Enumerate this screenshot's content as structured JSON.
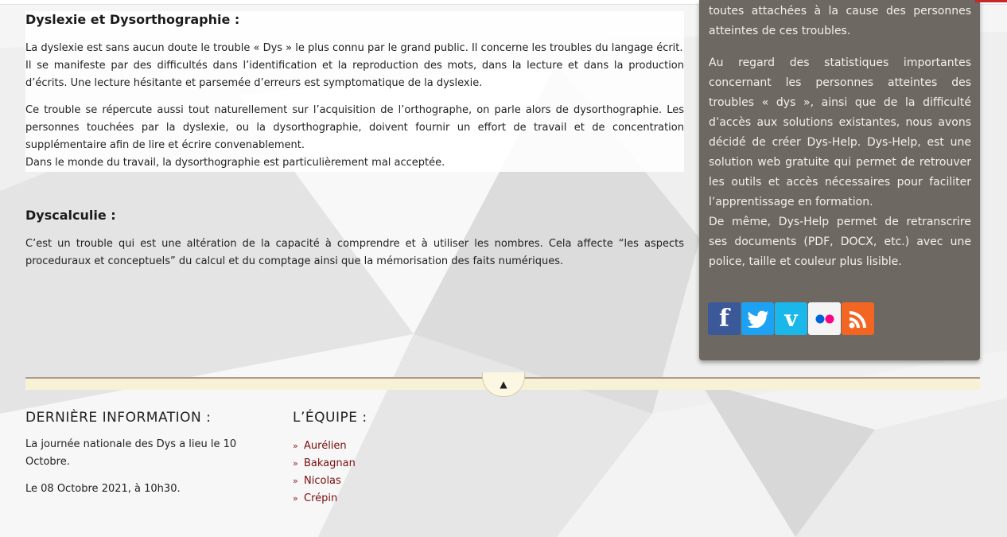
{
  "main": {
    "dyslexie": {
      "title": "Dyslexie et Dysorthographie :",
      "p1_line1": "La dyslexie est sans aucun doute le trouble « Dys » le plus connu par le grand public. Il concerne les troubles du langage écrit.",
      "p1_line2": "Il se manifeste par des difficultés dans l’identification et la reproduction des mots, dans la lecture et dans la production d’écrits. Une lecture hésitante et parsemée d’erreurs est symptomatique de la dyslexie.",
      "p2_line1": "Ce trouble se répercute aussi tout naturellement sur l’acquisition de l’orthographe, on parle alors de dysorthographie. Les personnes touchées par la dyslexie, ou la dysorthographie, doivent fournir un effort de travail et de concentration supplémentaire afin de lire et écrire convenablement.",
      "p2_line2": "Dans le monde du travail, la dysorthographie est particulièrement mal acceptée."
    },
    "dyscalculie": {
      "title": "Dyscalculie :",
      "p1": "C’est un trouble qui est une altération de la capacité à comprendre et à utiliser les nombres. Cela affecte “les aspects proceduraux et conceptuels” du calcul et du comptage ainsi que la mémorisation des faits numériques."
    }
  },
  "sidebar": {
    "p1": "toutes attachées à la cause des personnes atteintes de ces troubles.",
    "p2": "Au regard des statistiques importantes concernant les personnes atteintes des troubles « dys », ainsi que de la difficulté d’accès aux solutions existantes, nous avons décidé de créer Dys-Help. Dys-Help, est une solution web gratuite qui permet de retrouver les outils et accès nécessaires pour faciliter l’apprentissage en formation.",
    "p3": "De même, Dys-Help permet de retranscrire ses documents (PDF, DOCX, etc.) avec une police, taille et couleur plus lisible.",
    "social": [
      {
        "icon": "facebook-icon",
        "glyph": "f",
        "color": "#3b5998"
      },
      {
        "icon": "twitter-icon",
        "glyph": "🐦",
        "color": "#1da1f2"
      },
      {
        "icon": "vimeo-icon",
        "glyph": "v",
        "color": "#1ab7ea"
      },
      {
        "icon": "flickr-icon",
        "glyph": "●●",
        "color": "#f4f4f4"
      },
      {
        "icon": "rss-icon",
        "glyph": ")",
        "color": "#f26522"
      }
    ]
  },
  "footer": {
    "info": {
      "title": "DERNIÈRE INFORMATION :",
      "p1": "La journée nationale des Dys a lieu le 10 Octobre.",
      "p2": "Le 08 Octobre 2021, à 10h30."
    },
    "team": {
      "title": "L’ÉQUIPE :",
      "members": [
        "Aurélien",
        "Bakagnan",
        "Nicolas",
        "Crépin"
      ]
    }
  }
}
